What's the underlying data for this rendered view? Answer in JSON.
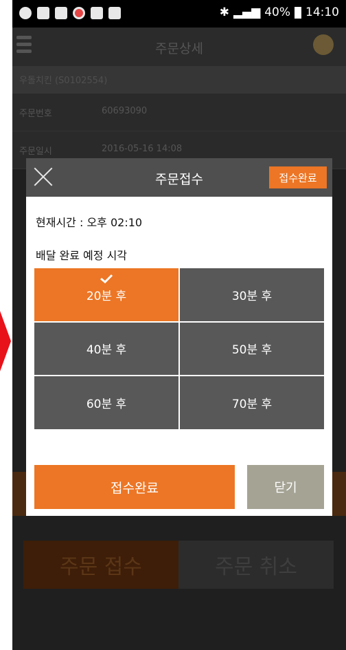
{
  "status": {
    "battery": "40%",
    "time": "14:10"
  },
  "header": {
    "title": "주문상세"
  },
  "store": {
    "name": "우돌치킨 (S0102554)"
  },
  "details": [
    {
      "label": "주문번호",
      "value": "60693090"
    },
    {
      "label": "주문일시",
      "value": "2016-05-16 14:08"
    }
  ],
  "bottom": {
    "accept_label": "주문 접수",
    "cancel_label": "주문 취소"
  },
  "modal": {
    "title": "주문접수",
    "done_label": "접수완료",
    "current_time": "현재시간 : 오후 02:10",
    "eta_label": "배달 완료 예정 시각",
    "options": [
      "20분 후",
      "30분 후",
      "40분 후",
      "50분 후",
      "60분 후",
      "70분 후"
    ],
    "selected": "20분 후",
    "accept_label": "접수완료",
    "close_label": "닫기"
  },
  "colors": {
    "accent": "#ec7625",
    "option": "#585858",
    "close_button": "#a5a394"
  }
}
